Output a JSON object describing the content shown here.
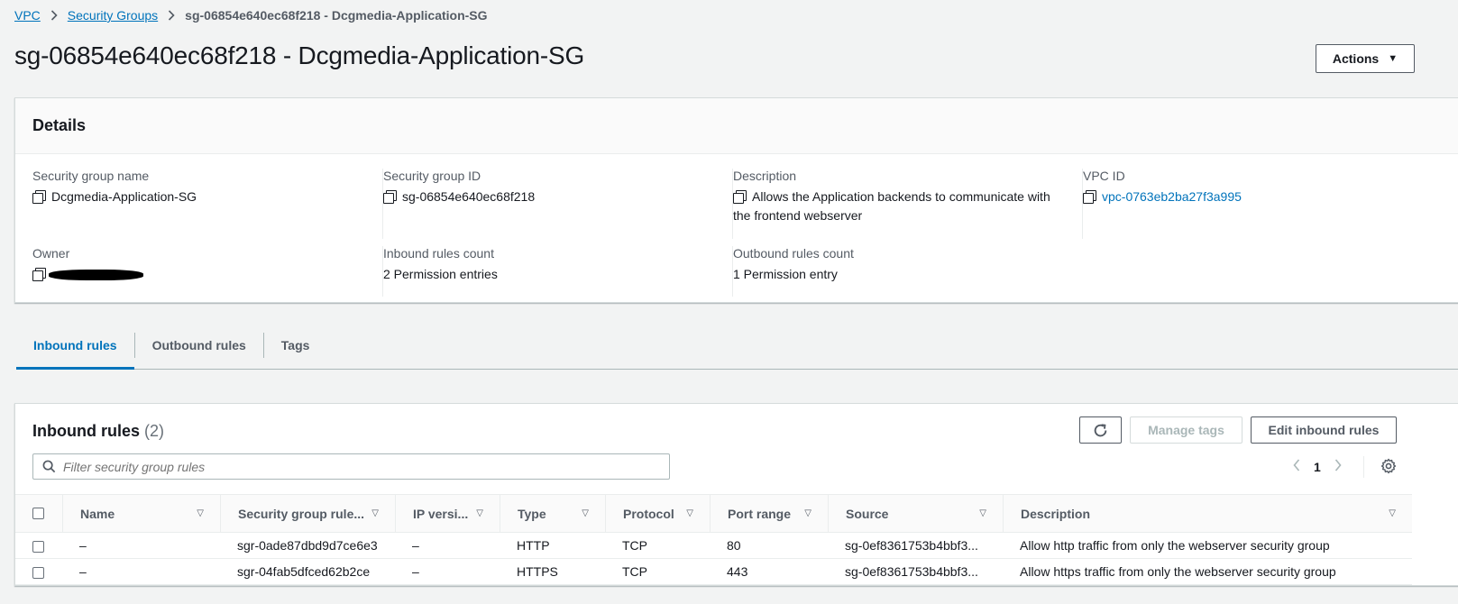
{
  "breadcrumb": {
    "vpc": "VPC",
    "security_groups": "Security Groups",
    "current": "sg-06854e640ec68f218 - Dcgmedia-Application-SG"
  },
  "page_title": "sg-06854e640ec68f218 - Dcgmedia-Application-SG",
  "actions_label": "Actions",
  "details": {
    "header": "Details",
    "sg_name_label": "Security group name",
    "sg_name": "Dcgmedia-Application-SG",
    "sg_id_label": "Security group ID",
    "sg_id": "sg-06854e640ec68f218",
    "description_label": "Description",
    "description": "Allows the Application backends to communicate with the frontend webserver",
    "vpc_id_label": "VPC ID",
    "vpc_id": "vpc-0763eb2ba27f3a995",
    "owner_label": "Owner",
    "inbound_count_label": "Inbound rules count",
    "inbound_count": "2 Permission entries",
    "outbound_count_label": "Outbound rules count",
    "outbound_count": "1 Permission entry"
  },
  "tabs": [
    "Inbound rules",
    "Outbound rules",
    "Tags"
  ],
  "rules": {
    "title": "Inbound rules",
    "count": "(2)",
    "manage_tags": "Manage tags",
    "edit": "Edit inbound rules",
    "filter_placeholder": "Filter security group rules",
    "page": "1",
    "columns": [
      "Name",
      "Security group rule...",
      "IP versi...",
      "Type",
      "Protocol",
      "Port range",
      "Source",
      "Description"
    ],
    "rows": [
      [
        "–",
        "sgr-0ade87dbd9d7ce6e3",
        "–",
        "HTTP",
        "TCP",
        "80",
        "sg-0ef8361753b4bbf3...",
        "Allow http traffic from only the webserver security group"
      ],
      [
        "–",
        "sgr-04fab5dfced62b2ce",
        "–",
        "HTTPS",
        "TCP",
        "443",
        "sg-0ef8361753b4bbf3...",
        "Allow https traffic from only the webserver security group"
      ]
    ]
  },
  "colors": {
    "link": "#0073bb",
    "text": "#16191f",
    "muted": "#545b64"
  }
}
